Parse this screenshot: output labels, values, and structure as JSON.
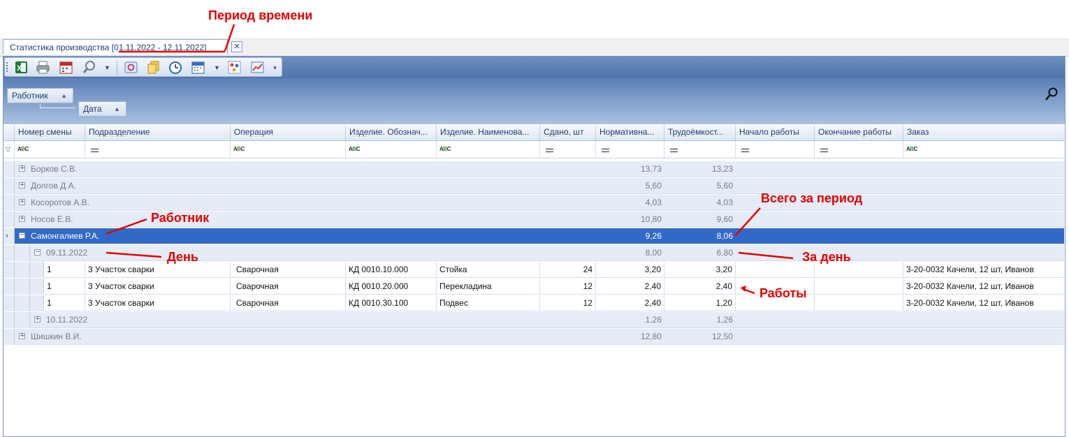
{
  "tab": {
    "title": "Статистика производства [01.11.2022 - 12.11.2022]",
    "close": "✕"
  },
  "grouping": {
    "level1": "Работник",
    "level2": "Дата"
  },
  "columns": [
    "Номер смены",
    "Подразделение",
    "Операция",
    "Изделие. Обознач...",
    "Изделие. Наименова...",
    "Сдано, шт",
    "Нормативна...",
    "Трудоёмкост...",
    "Начало работы",
    "Окончание работы",
    "Заказ"
  ],
  "workers": [
    {
      "name": "Борков С.В.",
      "norm": "13,73",
      "labor": "13,23"
    },
    {
      "name": "Долгов Д.А.",
      "norm": "5,60",
      "labor": "5,60"
    },
    {
      "name": "Косоротов А.В.",
      "norm": "4,03",
      "labor": "4,03"
    },
    {
      "name": "Носов Е.В.",
      "norm": "10,80",
      "labor": "9,60"
    },
    {
      "name": "Самонгалиев Р.А.",
      "norm": "9,26",
      "labor": "8,06"
    },
    {
      "name": "Шишкин В.И.",
      "norm": "12,80",
      "labor": "12,50"
    }
  ],
  "days": [
    {
      "date": "09.11.2022",
      "norm": "8,00",
      "labor": "6,80"
    },
    {
      "date": "10.11.2022",
      "norm": "1,26",
      "labor": "1,26"
    }
  ],
  "rows": [
    {
      "shift": "1",
      "dept": "3 Участок  сварки",
      "op": "Сварочная",
      "code": "КД 0010.10.000",
      "name": "Стойка",
      "qty": "24",
      "norm": "3,20",
      "labor": "3,20",
      "order": "3-20-0032 Качели, 12 шт, Иванов"
    },
    {
      "shift": "1",
      "dept": "3 Участок  сварки",
      "op": "Сварочная",
      "code": "КД 0010.20.000",
      "name": "Перекладина",
      "qty": "12",
      "norm": "2,40",
      "labor": "2,40",
      "order": "3-20-0032 Качели, 12 шт, Иванов"
    },
    {
      "shift": "1",
      "dept": "3 Участок  сварки",
      "op": "Сварочная",
      "code": "КД 0010.30.100",
      "name": "Подвес",
      "qty": "12",
      "norm": "2,40",
      "labor": "1,20",
      "order": "3-20-0032 Качели, 12 шт, Иванов"
    }
  ],
  "annotations": {
    "period": "Период времени",
    "worker": "Работник",
    "day": "День",
    "total": "Всего за период",
    "per_day": "За день",
    "jobs": "Работы"
  },
  "colors": {
    "selection": "#3169c6",
    "annotation": "#e60000",
    "toolbar": "#5175ab"
  }
}
